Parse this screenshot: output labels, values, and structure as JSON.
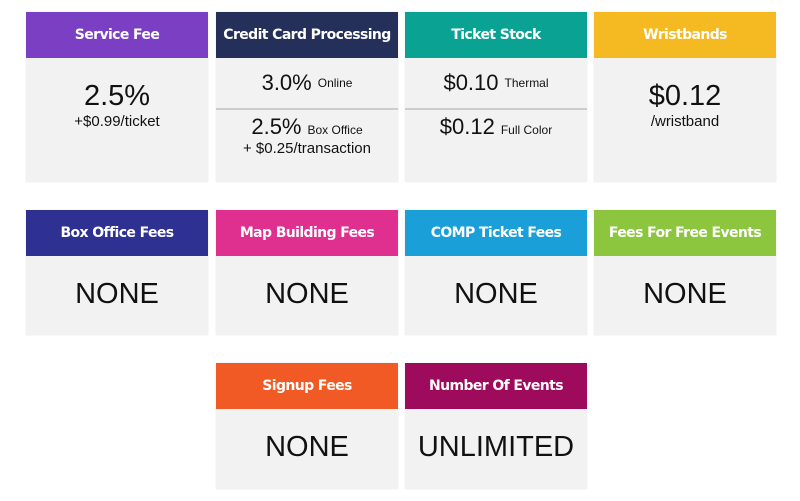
{
  "cards": [
    {
      "title": "Service Fee",
      "color": "#7b3fc4",
      "main": "2.5%",
      "sub": "+$0.99/ticket"
    },
    {
      "title": "Credit Card Processing",
      "color": "#25305a",
      "line1": {
        "value": "3.0%",
        "note": "Online"
      },
      "line2": {
        "value": "2.5%",
        "note": "Box Office",
        "sub": "+ $0.25/transaction"
      }
    },
    {
      "title": "Ticket Stock",
      "color": "#0aa393",
      "line1": {
        "value": "$0.10",
        "note": "Thermal"
      },
      "line2": {
        "value": "$0.12",
        "note": "Full Color"
      }
    },
    {
      "title": "Wristbands",
      "color": "#f5b921",
      "main": "$0.12",
      "sub": "/wristband"
    },
    {
      "title": "Box Office Fees",
      "color": "#2e3192",
      "value": "NONE"
    },
    {
      "title": "Map Building Fees",
      "color": "#e0308f",
      "value": "NONE"
    },
    {
      "title": "COMP Ticket Fees",
      "color": "#1a9fd9",
      "value": "NONE"
    },
    {
      "title": "Fees For Free Events",
      "color": "#8cc63f",
      "value": "NONE"
    },
    {
      "title": "Signup Fees",
      "color": "#f15a24",
      "value": "NONE"
    },
    {
      "title": "Number Of Events",
      "color": "#9e0b5c",
      "value": "UNLIMITED"
    }
  ]
}
